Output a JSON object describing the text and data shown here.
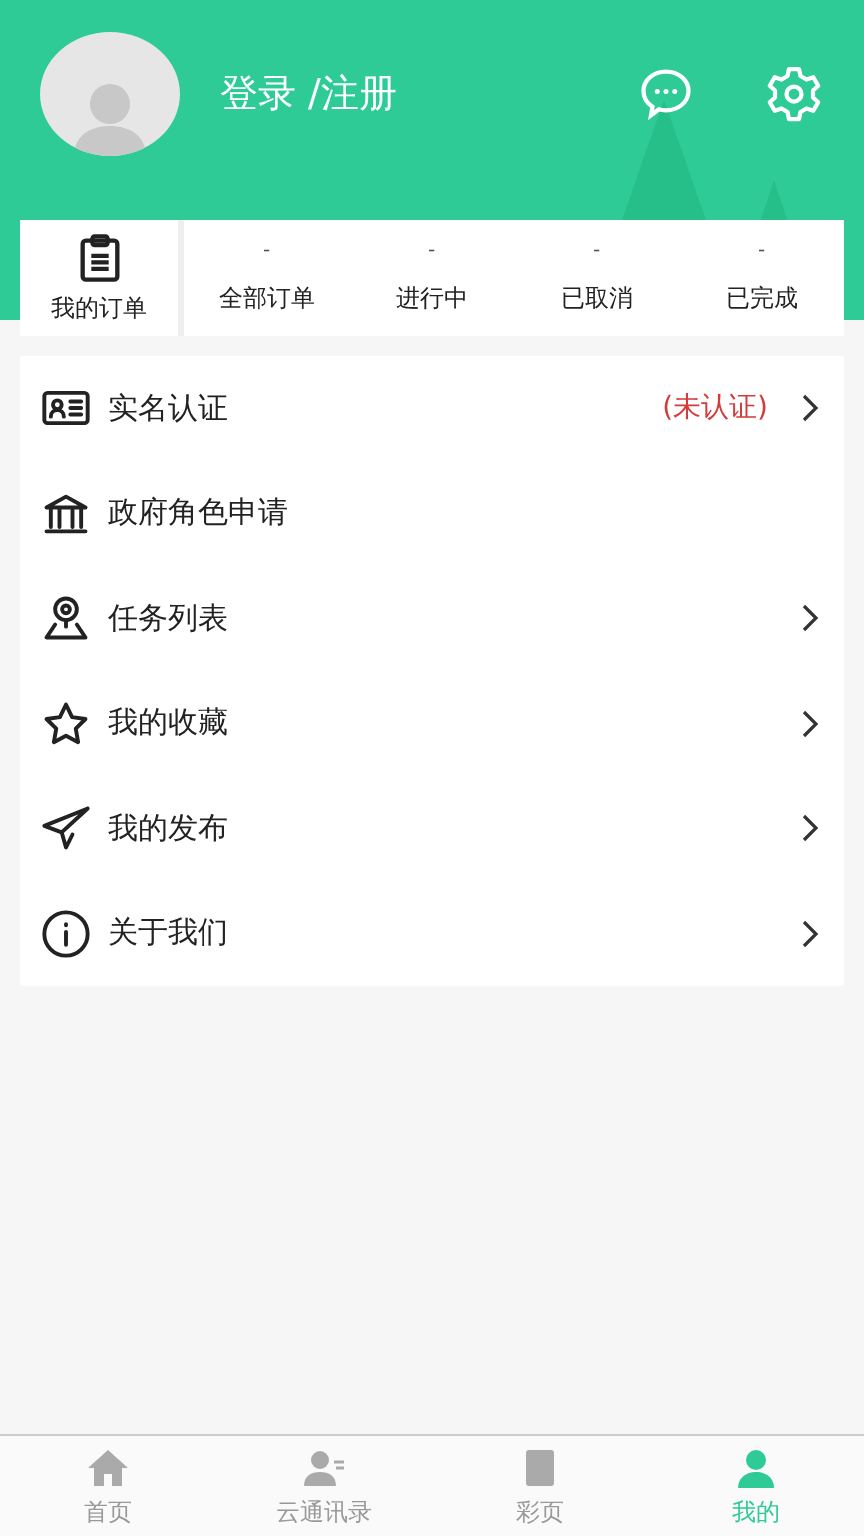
{
  "header": {
    "login_text": "登录 /注册"
  },
  "orders": {
    "title": "我的订单",
    "statuses": [
      {
        "count": "-",
        "label": "全部订单"
      },
      {
        "count": "-",
        "label": "进行中"
      },
      {
        "count": "-",
        "label": "已取消"
      },
      {
        "count": "-",
        "label": "已完成"
      }
    ]
  },
  "menu": [
    {
      "kind": "idcard",
      "label": "实名认证",
      "status": "(未认证)",
      "chevron": true
    },
    {
      "kind": "bank",
      "label": "政府角色申请",
      "chevron": false
    },
    {
      "kind": "pin",
      "label": "任务列表",
      "chevron": true
    },
    {
      "kind": "star",
      "label": "我的收藏",
      "chevron": true
    },
    {
      "kind": "send",
      "label": "我的发布",
      "chevron": true
    },
    {
      "kind": "info",
      "label": "关于我们",
      "chevron": true
    }
  ],
  "tabbar": [
    {
      "kind": "home",
      "label": "首页",
      "selected": false
    },
    {
      "kind": "contacts",
      "label": "云通讯录",
      "selected": false
    },
    {
      "kind": "doc",
      "label": "彩页",
      "selected": false
    },
    {
      "kind": "me",
      "label": "我的",
      "selected": true
    }
  ]
}
